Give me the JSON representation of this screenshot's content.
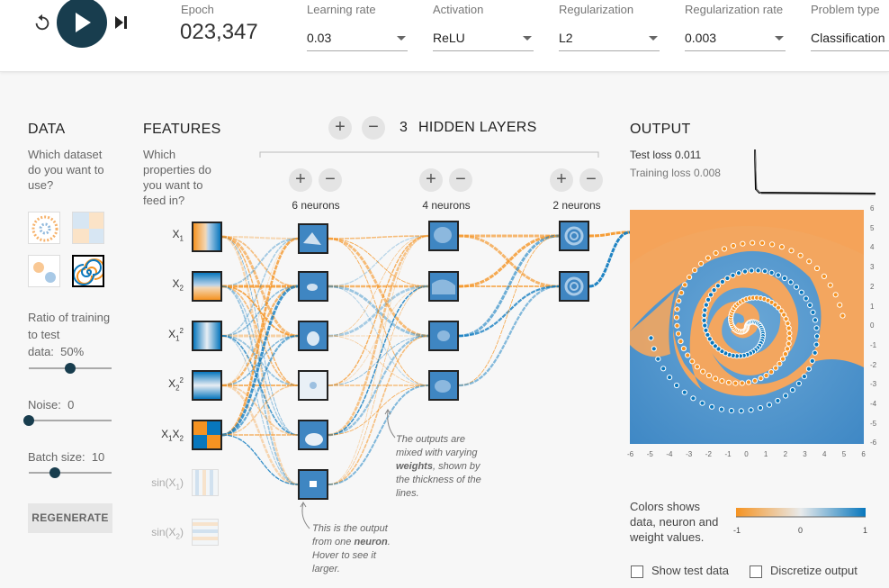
{
  "controls": {
    "epoch_label": "Epoch",
    "epoch_value": "023,347",
    "learning_rate_label": "Learning rate",
    "learning_rate_value": "0.03",
    "activation_label": "Activation",
    "activation_value": "ReLU",
    "regularization_label": "Regularization",
    "regularization_value": "L2",
    "regularization_rate_label": "Regularization rate",
    "regularization_rate_value": "0.003",
    "problem_type_label": "Problem type",
    "problem_type_value": "Classification"
  },
  "data_panel": {
    "title": "DATA",
    "question": "Which dataset do you want to use?",
    "ratio_label": "Ratio of training to test",
    "ratio_line2": "data:",
    "ratio_value": "50%",
    "ratio_fraction": 0.5,
    "noise_label": "Noise:",
    "noise_value": "0",
    "noise_fraction": 0,
    "batch_label": "Batch size:",
    "batch_value": "10",
    "batch_fraction": 0.32,
    "regenerate_label": "REGENERATE"
  },
  "features": {
    "title": "FEATURES",
    "question": "Which properties do you want to feed in?",
    "items": [
      {
        "label": "X1",
        "active": true
      },
      {
        "label": "X2",
        "active": true
      },
      {
        "label": "X1²",
        "active": true
      },
      {
        "label": "X2²",
        "active": true
      },
      {
        "label": "X1X2",
        "active": true
      },
      {
        "label": "sin(X1)",
        "active": false
      },
      {
        "label": "sin(X2)",
        "active": false
      }
    ]
  },
  "network": {
    "layer_count": "3",
    "hidden_layers_label": "HIDDEN LAYERS",
    "layers": [
      {
        "neurons_label": "6 neurons"
      },
      {
        "neurons_label": "4 neurons"
      },
      {
        "neurons_label": "2 neurons"
      }
    ],
    "note_weights": "The outputs are mixed with varying weights, shown by the thickness of the lines.",
    "note_neuron": "This is the output from one neuron. Hover to see it larger."
  },
  "output": {
    "title": "OUTPUT",
    "test_loss_label": "Test loss",
    "test_loss_value": "0.011",
    "training_loss_label": "Training loss",
    "training_loss_value": "0.008",
    "x_ticks": [
      "-6",
      "-5",
      "-4",
      "-3",
      "-2",
      "-1",
      "0",
      "1",
      "2",
      "3",
      "4",
      "5",
      "6"
    ],
    "y_ticks": [
      "6",
      "5",
      "4",
      "3",
      "2",
      "1",
      "0",
      "-1",
      "-2",
      "-3",
      "-4",
      "-5",
      "-6"
    ],
    "colors_note": "Colors shows data, neuron and weight values.",
    "legend_min": "-1",
    "legend_mid": "0",
    "legend_max": "1",
    "show_test_label": "Show test data",
    "discretize_label": "Discretize output",
    "show_test_checked": false,
    "discretize_checked": false
  },
  "colors": {
    "orange": "#f59322",
    "blue": "#0877bd",
    "dark": "#183d4e"
  }
}
